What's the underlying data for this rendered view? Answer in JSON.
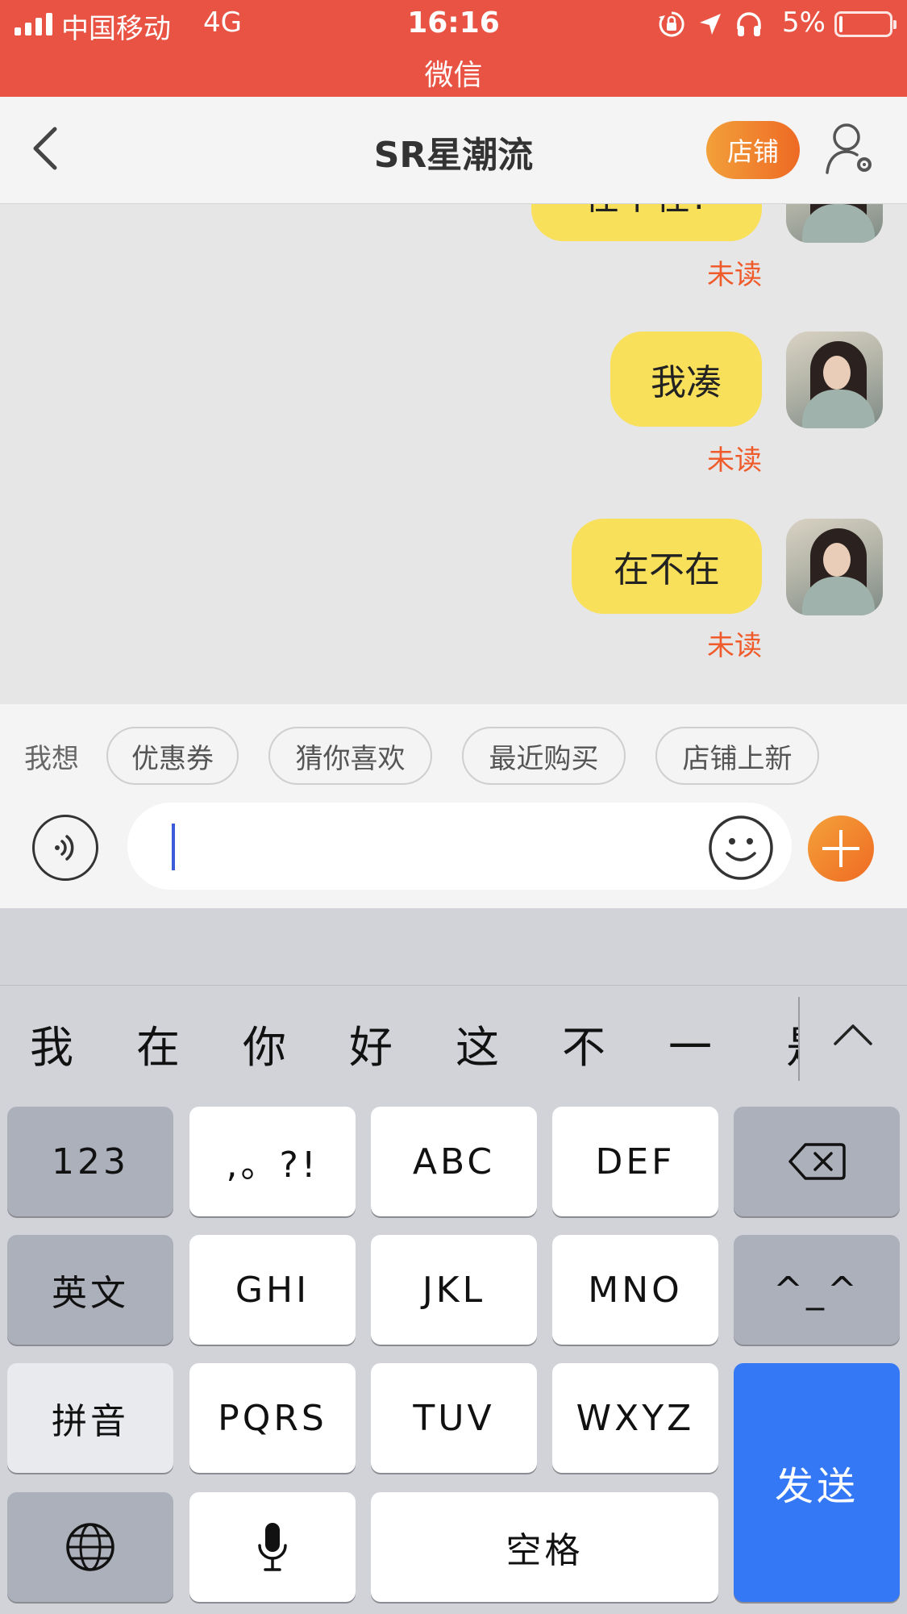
{
  "status_bar": {
    "carrier": "中国移动",
    "network": "4G",
    "time": "16:16",
    "sub_app": "微信",
    "battery_percent": "5%",
    "battery_level": 0.05,
    "background_color": "#e95343"
  },
  "nav": {
    "title": "SR星潮流",
    "shop_button": "店铺"
  },
  "messages": [
    {
      "text": "在不在?",
      "status": "未读"
    },
    {
      "text": "我凑",
      "status": "未读"
    },
    {
      "text": "在不在",
      "status": "未读"
    }
  ],
  "quick_replies": {
    "label": "我想",
    "chips": [
      "优惠券",
      "猜你喜欢",
      "最近购买",
      "店铺上新"
    ]
  },
  "input": {
    "value": ""
  },
  "keyboard": {
    "candidates": [
      "我",
      "在",
      "你",
      "好",
      "这",
      "不",
      "一",
      "是"
    ],
    "rows": [
      [
        "123",
        ",。?!",
        "ABC",
        "DEF",
        "delete"
      ],
      [
        "英文",
        "GHI",
        "JKL",
        "MNO",
        "^_^"
      ],
      [
        "拼音",
        "PQRS",
        "TUV",
        "WXYZ"
      ],
      [
        "globe",
        "mic",
        "空格"
      ]
    ],
    "send": "发送",
    "accent_color": "#3478f6"
  }
}
